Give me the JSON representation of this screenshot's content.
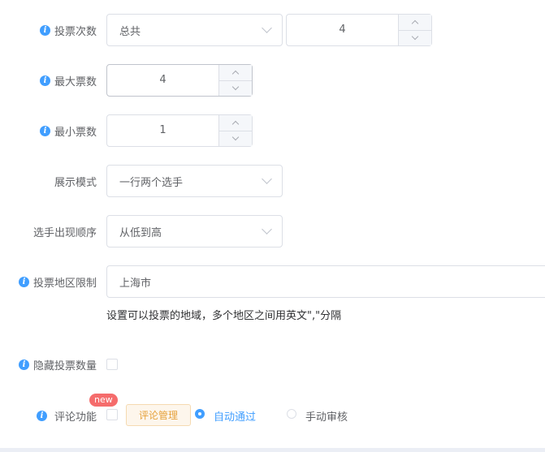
{
  "vote_count": {
    "label": "投票次数",
    "select_value": "总共",
    "number": "4"
  },
  "max_votes": {
    "label": "最大票数",
    "number": "4"
  },
  "min_votes": {
    "label": "最小票数",
    "number": "1"
  },
  "display_mode": {
    "label": "展示模式",
    "value": "一行两个选手"
  },
  "order": {
    "label": "选手出现顺序",
    "value": "从低到高"
  },
  "region": {
    "label": "投票地区限制",
    "value": "上海市",
    "help": "设置可以投票的地域，多个地区之间用英文\",\"分隔"
  },
  "hide_count": {
    "label": "隐藏投票数量"
  },
  "comment": {
    "label": "评论功能",
    "badge": "new",
    "manage_button": "评论管理",
    "option_auto": "自动通过",
    "option_manual": "手动审核",
    "selected": "auto"
  },
  "colors": {
    "accent": "#409eff",
    "badge": "#f56c6c",
    "warning": "#e6a23c"
  }
}
